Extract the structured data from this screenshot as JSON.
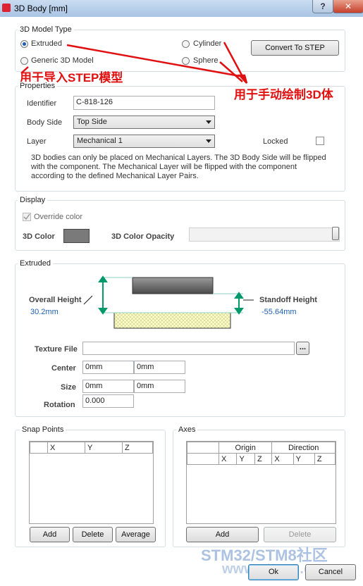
{
  "window": {
    "title": "3D Body [mm]",
    "help": "?",
    "close": "✕"
  },
  "model_type": {
    "group_label": "3D Model Type",
    "extruded": "Extruded",
    "generic": "Generic 3D Model",
    "cylinder": "Cylinder",
    "sphere": "Sphere",
    "convert_button": "Convert To STEP",
    "selected": "Extruded"
  },
  "annotations": {
    "import_step": "用于导入STEP模型",
    "manual_draw": "用于手动绘制3D体",
    "arrow_color": "#e01010"
  },
  "properties": {
    "group_label": "Properties",
    "identifier_label": "Identifier",
    "identifier_value": "C-818-126",
    "body_side_label": "Body Side",
    "body_side_value": "Top Side",
    "layer_label": "Layer",
    "layer_value": "Mechanical 1",
    "locked_label": "Locked",
    "info": "3D bodies can only be placed on Mechanical Layers. The 3D Body Side will be flipped with the component. The Mechanical Layer will be flipped with the component according to the defined Mechanical Layer Pairs."
  },
  "display": {
    "group_label": "Display",
    "override_label": "Override color",
    "color_label": "3D Color",
    "color_value": "#7a7a7a",
    "opacity_label": "3D Color Opacity",
    "opacity_value": 1.0
  },
  "extruded": {
    "group_label": "Extruded",
    "overall_height_label": "Overall Height",
    "overall_height_value": "30.2mm",
    "standoff_label": "Standoff Height",
    "standoff_value": "-55.64mm",
    "texture_label": "Texture File",
    "texture_value": "",
    "browse": "...",
    "center_label": "Center",
    "center_x": "0mm",
    "center_y": "0mm",
    "size_label": "Size",
    "size_x": "0mm",
    "size_y": "0mm",
    "rotation_label": "Rotation",
    "rotation_value": "0.000"
  },
  "snap_points": {
    "group_label": "Snap Points",
    "columns": [
      "",
      "X",
      "Y",
      "Z"
    ],
    "add": "Add",
    "delete": "Delete",
    "average": "Average"
  },
  "axes": {
    "group_label": "Axes",
    "origin": "Origin",
    "direction": "Direction",
    "columns": [
      "",
      "X",
      "Y",
      "Z",
      "X",
      "Y",
      "Z"
    ],
    "add": "Add",
    "delete": "Delete"
  },
  "footer": {
    "ok": "Ok",
    "cancel": "Cancel",
    "watermark": "STM32/STM8社区",
    "watermark_url": "www.stmcu.org.cn"
  }
}
